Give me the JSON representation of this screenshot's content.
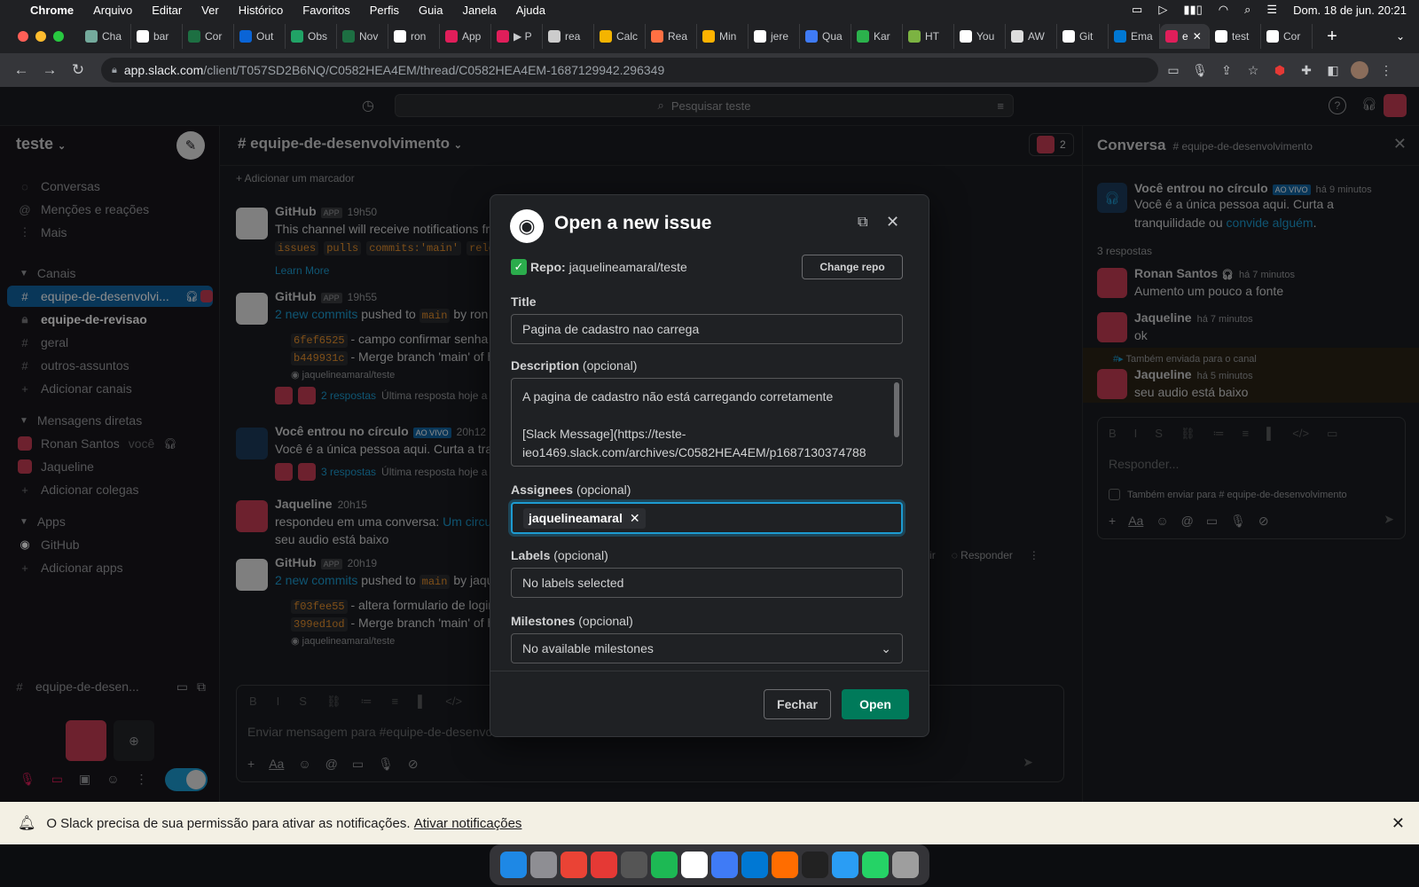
{
  "menubar": {
    "app": "Chrome",
    "items": [
      "Arquivo",
      "Editar",
      "Ver",
      "Histórico",
      "Favoritos",
      "Perfis",
      "Guia",
      "Janela",
      "Ajuda"
    ],
    "clock": "Dom. 18 de jun.  20:21"
  },
  "tabs": [
    {
      "label": "Cha",
      "color": "#74aa9c"
    },
    {
      "label": "bar",
      "color": "#ffffff"
    },
    {
      "label": "Cor",
      "color": "#1d6f42"
    },
    {
      "label": "Out",
      "color": "#0a64d6"
    },
    {
      "label": "Obs",
      "color": "#21a366"
    },
    {
      "label": "Nov",
      "color": "#1d6f42"
    },
    {
      "label": "ron",
      "color": "#ffffff"
    },
    {
      "label": "App",
      "color": "#e01e5a"
    },
    {
      "label": "▶ P",
      "color": "#e01e5a"
    },
    {
      "label": "rea",
      "color": "#cccccc"
    },
    {
      "label": "Calc",
      "color": "#f4b400"
    },
    {
      "label": "Rea",
      "color": "#ff7043"
    },
    {
      "label": "Min",
      "color": "#ffb300"
    },
    {
      "label": "jere",
      "color": "#ffffff"
    },
    {
      "label": "Qua",
      "color": "#3f7bf6"
    },
    {
      "label": "Kar",
      "color": "#2bb24c"
    },
    {
      "label": "HT",
      "color": "#7cb342"
    },
    {
      "label": "You",
      "color": "#ffffff"
    },
    {
      "label": "AW",
      "color": "#dddddd"
    },
    {
      "label": "Git",
      "color": "#ffffff"
    },
    {
      "label": "Ema",
      "color": "#0078d4"
    },
    {
      "label": "e",
      "color": "#e01e5a"
    },
    {
      "label": "test",
      "color": "#ffffff"
    },
    {
      "label": "Cor",
      "color": "#ffffff"
    }
  ],
  "address": {
    "host": "app.slack.com",
    "path": "/client/T057SD2B6NQ/C0582HEA4EM/thread/C0582HEA4EM-1687129942.296349"
  },
  "slack": {
    "search_placeholder": "Pesquisar teste",
    "workspace": "teste",
    "nav": [
      "Conversas",
      "Menções e reações",
      "Mais"
    ],
    "channels_header": "Canais",
    "channels": [
      "equipe-de-desenvolvi...",
      "equipe-de-revisao",
      "geral",
      "outros-assuntos"
    ],
    "add_channels": "Adicionar canais",
    "dm_header": "Mensagens diretas",
    "dms": [
      {
        "name": "Ronan Santos",
        "suffix": "você"
      },
      {
        "name": "Jaqueline",
        "suffix": ""
      }
    ],
    "add_colleagues": "Adicionar colegas",
    "apps_header": "Apps",
    "apps": [
      "GitHub"
    ],
    "add_apps": "Adicionar apps",
    "huddle_channel": "equipe-de-desen...",
    "channel_title": "# equipe-de-desenvolvimento",
    "member_count": "2",
    "bookmark": "+ Adicionar um marcador",
    "messages": {
      "m1": {
        "name": "GitHub",
        "badge": "APP",
        "time": "19h50",
        "text": "This channel will receive notifications fr",
        "codes": [
          "issues",
          "pulls",
          "commits:'main'",
          "rele"
        ],
        "learn": "Learn More"
      },
      "m2": {
        "name": "GitHub",
        "badge": "APP",
        "time": "19h55",
        "commits_link": "2 new commits",
        "pushed": "pushed to",
        "branch": "main",
        "by": "by ron",
        "c1_hash": "6fef6525",
        "c1_text": "- campo confirmar senha",
        "c2_hash": "b449931c",
        "c2_text": "- Merge branch 'main' of h",
        "repo": "jaquelineamaral/teste",
        "replies": "2 respostas",
        "last": "Última resposta hoje a"
      },
      "m3": {
        "name": "Você entrou no círculo",
        "badge": "AO VIVO",
        "time": "20h12",
        "text": "Você é a única pessoa aqui. Curta a tran",
        "replies": "3 respostas",
        "last": "Última resposta hoje a"
      },
      "m4": {
        "name": "Jaqueline",
        "time": "20h15",
        "text1": "respondeu em uma conversa:",
        "link": "Um circu",
        "text2": "seu audio está baixo"
      },
      "m5": {
        "name": "GitHub",
        "badge": "APP",
        "time": "20h19",
        "commits_link": "2 new commits",
        "pushed": "pushed to",
        "branch": "main",
        "by": "by jaqu",
        "c1_hash": "f03fee55",
        "c1_text": "- altera formulario de login",
        "c2_hash": "399ed1od",
        "c2_text": "- Merge branch 'main' of h",
        "repo": "jaquelineamaral/teste"
      }
    },
    "hover_actions": {
      "react": "eagir",
      "reply": "Responder"
    },
    "composer_placeholder": "Enviar mensagem para #equipe-de-desenvolvimento",
    "thread": {
      "title": "Conversa",
      "channel": "# equipe-de-desenvolvimento",
      "root_name": "Você entrou no círculo",
      "root_badge": "AO VIVO",
      "root_time": "há 9 minutos",
      "root_text": "Você é a única pessoa aqui. Curta a tranquilidade ou",
      "root_link": "convide alguém",
      "count": "3 respostas",
      "replies": [
        {
          "name": "Ronan Santos",
          "time": "há 7 minutos",
          "text": "Aumento um pouco a fonte"
        },
        {
          "name": "Jaqueline",
          "time": "há 7 minutos",
          "text": "ok"
        },
        {
          "name": "Jaqueline",
          "time": "há 5 minutos",
          "text": "seu audio está baixo",
          "note": "Também enviada para o canal"
        }
      ],
      "reply_placeholder": "Responder...",
      "also_send": "Também enviar para # equipe-de-desenvolvimento"
    },
    "notif": {
      "text": "O Slack precisa de sua permissão para ativar as notificações.",
      "link": "Ativar notificações"
    }
  },
  "modal": {
    "title": "Open a new issue",
    "repo_label": "Repo:",
    "repo": "jaquelineamaral/teste",
    "change_repo": "Change repo",
    "title_label": "Title",
    "title_value": "Pagina de cadastro nao carrega",
    "desc_label": "Description",
    "optional": "(opcional)",
    "desc_line1": "A pagina de cadastro não está carregando corretamente",
    "desc_line2": "[Slack Message](https://teste-",
    "desc_line3": "ieo1469.slack.com/archives/C0582HEA4EM/p1687130374788",
    "assignees_label": "Assignees",
    "assignee": "jaquelineamaral",
    "labels_label": "Labels",
    "labels_value": "No labels selected",
    "milestones_label": "Milestones",
    "milestones_value": "No available milestones",
    "cancel": "Fechar",
    "submit": "Open"
  },
  "colors": {
    "slack_green": "#007a5a",
    "focus_blue": "#1d9bd1",
    "active_channel": "#1164a3"
  },
  "dock": [
    "#1e88e5",
    "#8e8e93",
    "#ea4335",
    "#e53935",
    "#555555",
    "#1db954",
    "#ffffff",
    "#3f7bf6",
    "#0078d4",
    "#ff6d00",
    "#222222",
    "#2a9df4",
    "#25d366",
    "#9e9e9e"
  ]
}
